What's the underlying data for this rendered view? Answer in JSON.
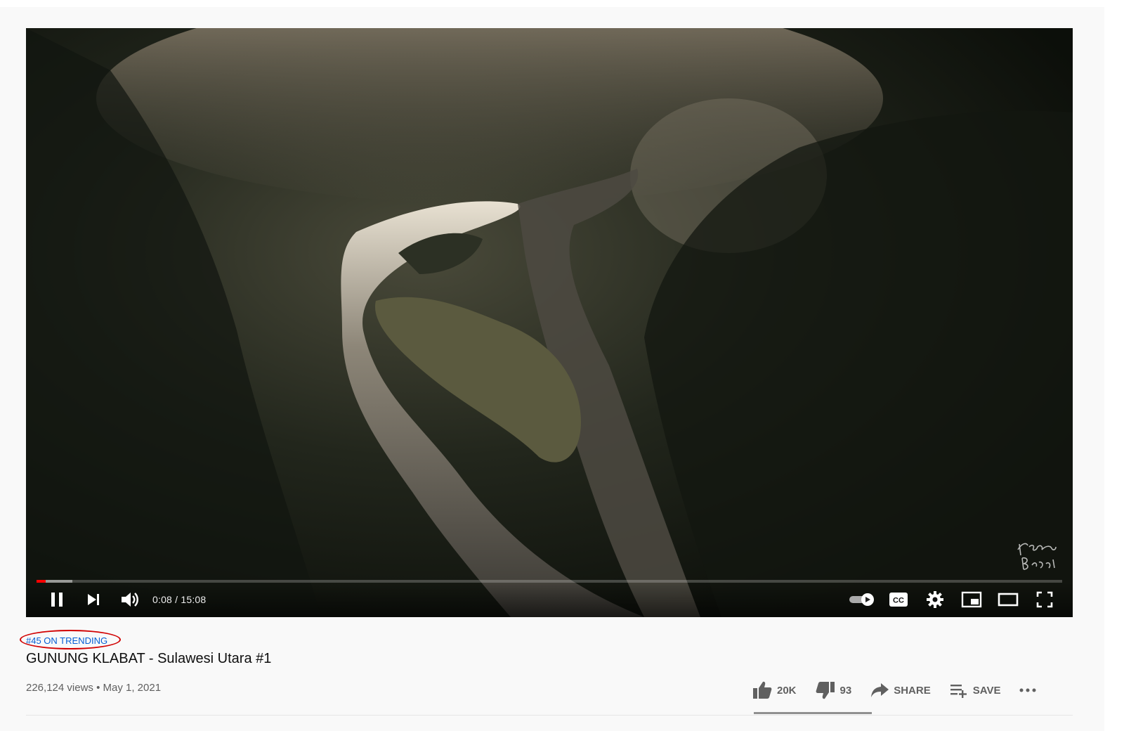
{
  "player": {
    "time_current": "0:08",
    "time_separator": " / ",
    "time_total": "15:08",
    "progress_played_fraction": 0.0088,
    "progress_loaded_fraction": 0.035,
    "icons": [
      "pause-icon",
      "next-icon",
      "volume-icon",
      "autoplay-toggle-icon",
      "captions-icon",
      "settings-icon",
      "miniplayer-icon",
      "theater-icon",
      "fullscreen-icon"
    ],
    "accent_color": "#ff0000",
    "watermark_text": "Fiersa Besari"
  },
  "video": {
    "trending_label": "#45 ON TRENDING",
    "title": "GUNUNG KLABAT - Sulawesi Utara #1",
    "views": "226,124 views",
    "separator": " • ",
    "date": "May 1, 2021"
  },
  "actions": {
    "like_count": "20K",
    "dislike_count": "93",
    "share_label": "SHARE",
    "save_label": "SAVE",
    "more_icon": "more-horiz-icon"
  },
  "colors": {
    "link": "#065fd4",
    "annotation": "#d10000"
  }
}
